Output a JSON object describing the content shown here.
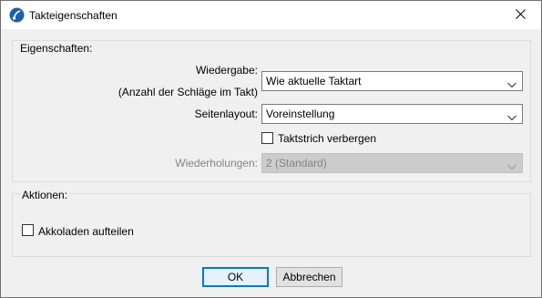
{
  "window": {
    "title": "Takteigenschaften",
    "icon": "music-note-icon",
    "close_icon": "close-icon"
  },
  "properties_group": {
    "title": "Eigenschaften:",
    "playback_label": "Wiedergabe:",
    "playback_sublabel": "(Anzahl der Schläge im Takt)",
    "playback_value": "Wie aktuelle Taktart",
    "page_layout_label": "Seitenlayout:",
    "page_layout_value": "Voreinstellung",
    "hide_barline_label": "Taktstrich verbergen",
    "hide_barline_checked": false,
    "repeats_label": "Wiederholungen:",
    "repeats_value": "2 (Standard)",
    "repeats_enabled": false
  },
  "actions_group": {
    "title": "Aktionen:",
    "split_braces_label": "Akkoladen aufteilen",
    "split_braces_checked": false
  },
  "buttons": {
    "ok": "OK",
    "cancel": "Abbrechen"
  },
  "colors": {
    "dialog_bg": "#f0f0f0",
    "focus_border": "#0078d7",
    "disabled_text": "#838383",
    "app_icon": "#1f5fae"
  }
}
